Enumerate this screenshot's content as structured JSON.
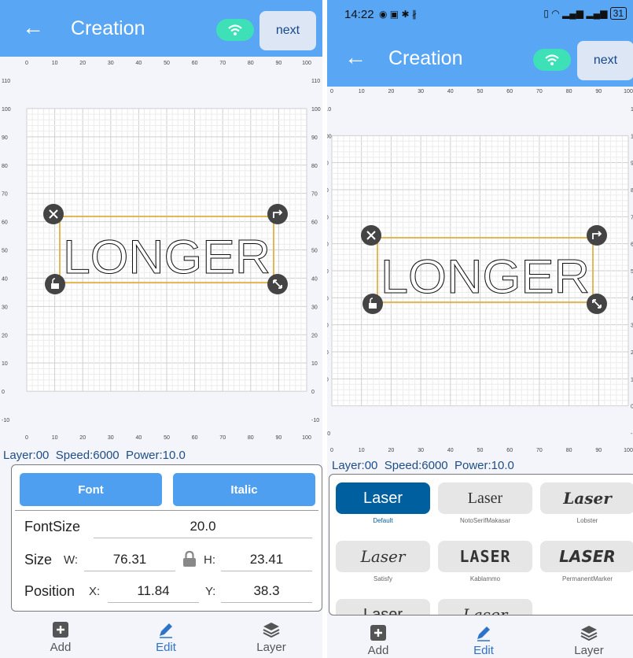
{
  "left": {
    "app": {
      "title": "Creation",
      "next_label": "next"
    },
    "status_line": {
      "layer": "Layer:00",
      "speed": "Speed:6000",
      "power": "Power:10.0"
    },
    "canvas": {
      "text": "LONGER"
    },
    "tabs": {
      "font": "Font",
      "italic": "Italic"
    },
    "fontsize": {
      "label": "FontSize",
      "value": "20.0"
    },
    "size": {
      "label": "Size",
      "w_label": "W:",
      "w_value": "76.31",
      "h_label": "H:",
      "h_value": "23.41"
    },
    "position": {
      "label": "Position",
      "x_label": "X:",
      "x_value": "11.84",
      "y_label": "Y:",
      "y_value": "38.3"
    },
    "nav": {
      "add": "Add",
      "edit": "Edit",
      "layer": "Layer"
    }
  },
  "right": {
    "status": {
      "time": "14:22",
      "battery": "31"
    },
    "app": {
      "title": "Creation",
      "next_label": "next"
    },
    "status_line": {
      "layer": "Layer:00",
      "speed": "Speed:6000",
      "power": "Power:10.0"
    },
    "canvas": {
      "text": "LONGER"
    },
    "fonts": [
      {
        "sample": "Laser",
        "name": "Default",
        "selected": true
      },
      {
        "sample": "Laser",
        "name": "NotoSerifMakasar"
      },
      {
        "sample": "Laser",
        "name": "Lobster"
      },
      {
        "sample": "Laser",
        "name": "Satisfy"
      },
      {
        "sample": "LASER",
        "name": "Kablammo"
      },
      {
        "sample": "LASER",
        "name": "PermanentMarker"
      },
      {
        "sample": "Laser",
        "name": ""
      },
      {
        "sample": "Laser",
        "name": ""
      }
    ],
    "nav": {
      "add": "Add",
      "edit": "Edit",
      "layer": "Layer"
    }
  },
  "axes": {
    "x_ticks": [
      "0",
      "10",
      "20",
      "30",
      "40",
      "50",
      "60",
      "70",
      "80",
      "90",
      "100"
    ],
    "y_ticks": [
      "110",
      "100",
      "90",
      "80",
      "70",
      "60",
      "50",
      "40",
      "30",
      "20",
      "10",
      "0",
      "-10"
    ]
  },
  "colors": {
    "blue": "#58a6f4",
    "selection": "#e0a82e",
    "accent_nav": "#2d73c9"
  }
}
